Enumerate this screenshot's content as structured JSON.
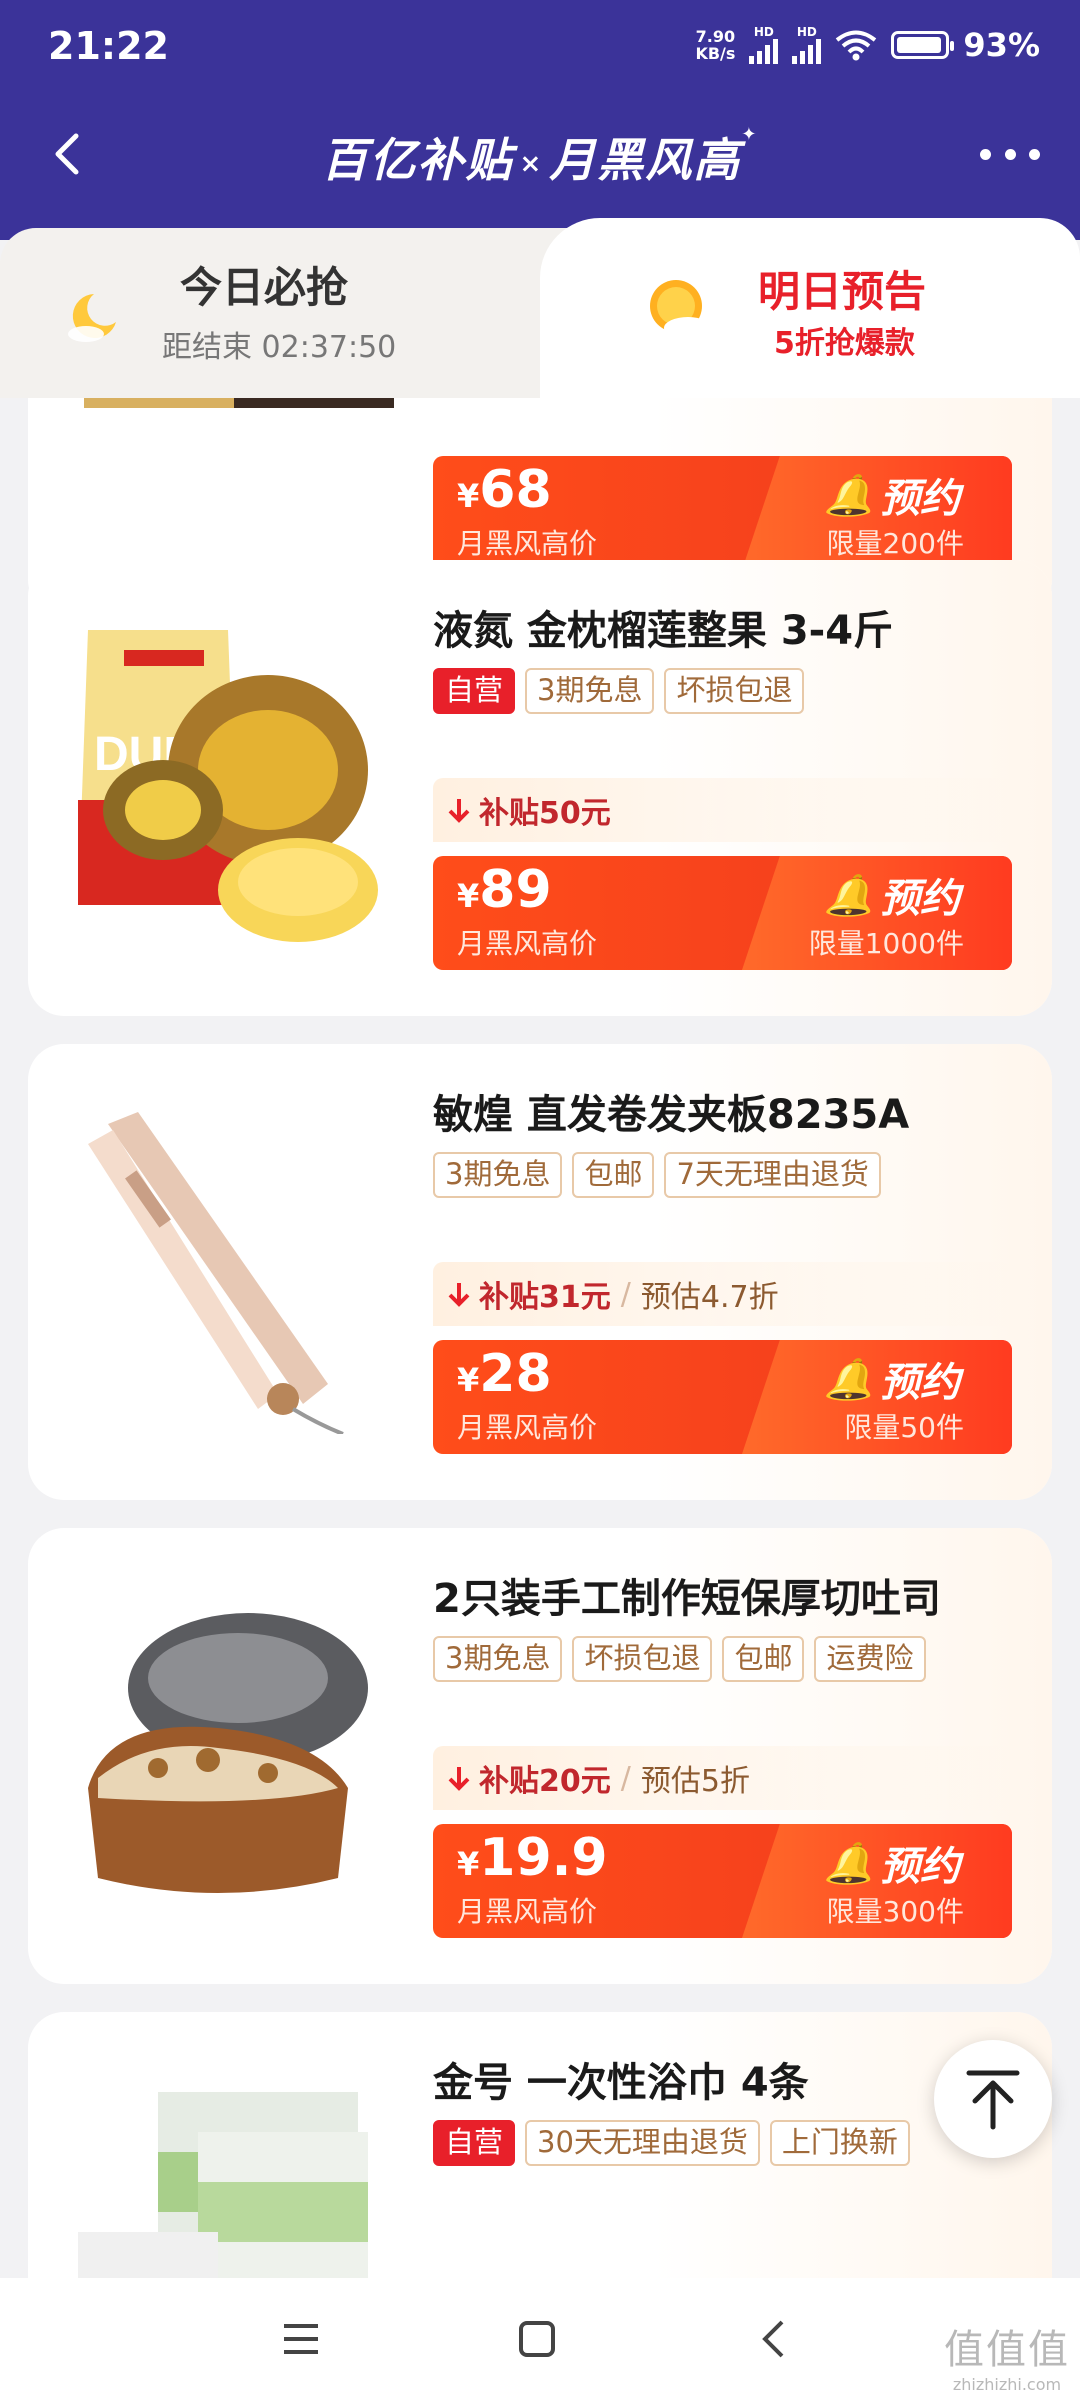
{
  "status": {
    "time": "21:22",
    "net_speed": "7.90",
    "net_unit": "KB/s",
    "battery": "93%",
    "hd": "HD"
  },
  "header": {
    "brand_left": "百亿补贴",
    "brand_x": "×",
    "brand_right": "月黑风高"
  },
  "tabs": {
    "today": {
      "title": "今日必抢",
      "countdown": "距结束 02:37:50"
    },
    "tomorrow": {
      "title": "明日预告",
      "sub": "5折抢爆款"
    }
  },
  "common": {
    "price_label": "月黑风高价",
    "reserve": "预约",
    "yen": "¥"
  },
  "products": [
    {
      "name": "",
      "price": "68",
      "limit": "限量200件",
      "tags": []
    },
    {
      "name": "液氮 金枕榴莲整果 3-4斤",
      "tags": [
        "自营",
        "3期免息",
        "坏损包退"
      ],
      "subsidy": "补贴50元",
      "estimate": "",
      "price": "89",
      "limit": "限量1000件"
    },
    {
      "name": "敏煌 直发卷发夹板8235A",
      "tags": [
        "3期免息",
        "包邮",
        "7天无理由退货"
      ],
      "subsidy": "补贴31元",
      "estimate": "预估4.7折",
      "price": "28",
      "limit": "限量50件"
    },
    {
      "name": "2只装手工制作短保厚切吐司",
      "tags": [
        "3期免息",
        "坏损包退",
        "包邮",
        "运费险"
      ],
      "subsidy": "补贴20元",
      "estimate": "预估5折",
      "price": "19.9",
      "limit": "限量300件"
    },
    {
      "name": "金号 一次性浴巾 4条",
      "tags": [
        "自营",
        "30天无理由退货",
        "上门换新"
      ]
    }
  ],
  "watermark": {
    "big": "值值值",
    "small": "zhizhizhi.com"
  },
  "colors": {
    "header": "#3b3399",
    "accent": "#f03a1e",
    "self_tag": "#e8202a",
    "tag_border": "#e8c9a8"
  }
}
